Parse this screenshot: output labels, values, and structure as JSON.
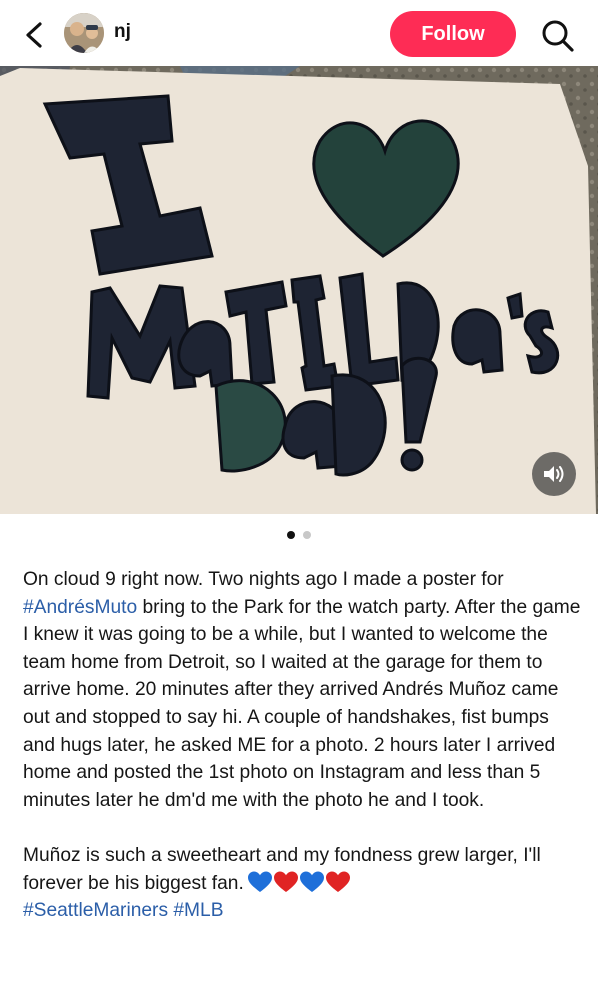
{
  "header": {
    "username": "nj",
    "follow_label": "Follow"
  },
  "post": {
    "image_pages": 2,
    "image_index": 1,
    "sign_text": [
      "I",
      "MATILDA'S",
      "DAD!"
    ]
  },
  "caption": {
    "p1_pre": "On cloud 9 right now. Two nights ago I made a poster for ",
    "p1_tag": "#AndrésMuto",
    "p1_post": " bring to the Park for the watch party. After the game I knew it was going to be a while, but I wanted to welcome the team home from Detroit, so I waited at the garage for them to arrive home. 20 minutes after they arrived Andrés Muñoz came out and stopped to say hi. A couple of handshakes, fist bumps and hugs later, he asked ME for a photo. 2 hours later I arrived home and posted the 1st photo on Instagram and less than 5 minutes later he dm'd me with the photo he and I took.",
    "p2_text": "Muñoz is such a sweetheart and my fondness grew larger, I'll forever be his biggest fan.",
    "emojis": [
      "blue-heart",
      "red-heart",
      "blue-heart",
      "red-heart"
    ],
    "tag1": "#SeattleMariners",
    "tag2": "#MLB"
  },
  "colors": {
    "follow_bg": "#fe2c55",
    "hashtag": "#2b5ea8",
    "heart_blue": "#1e6fd9",
    "heart_red": "#e02424"
  }
}
